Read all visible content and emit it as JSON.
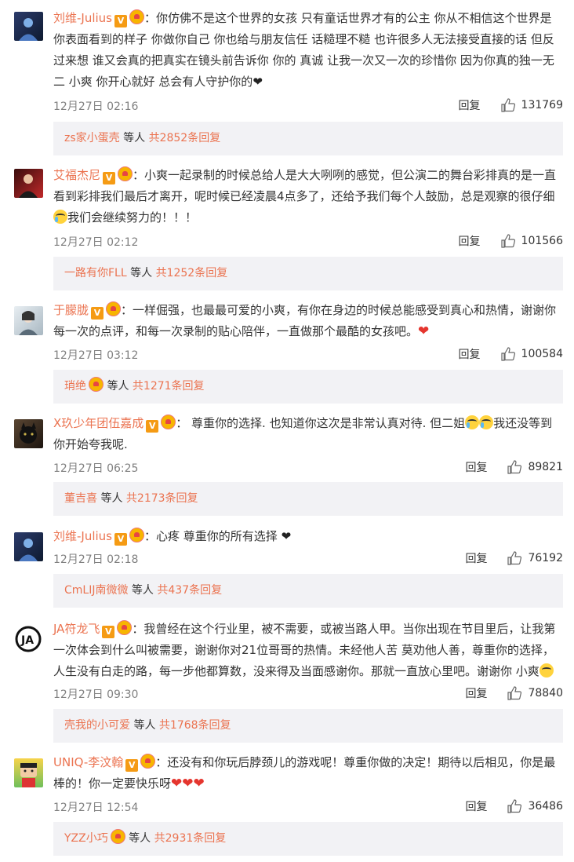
{
  "comments": [
    {
      "user": "刘维-Julius",
      "text": "：你仿佛不是这个世界的女孩 只有童话世界才有的公主 你从不相信这个世界是你表面看到的样子 你做你自己 你也给与朋友信任 话糙理不糙 也许很多人无法接受直接的话 但反过来想 谁又会真的把真实在镜头前告诉你 你的 真诚 让我一次又一次的珍惜你 因为你真的独一无二 小爽 你开心就好 总会有人守护你的",
      "end_icon": "black-heart",
      "time": "12月27日 02:16",
      "reply_label": "回复",
      "likes": "131769",
      "sub_user": "zs家小蛋壳",
      "sub_mid": " 等人 ",
      "sub_count": "共2852条回复"
    },
    {
      "user": "艾福杰尼",
      "text": "：小爽一起录制的时候总给人是大大咧咧的感觉，但公演二的舞台彩排真的是一直看到彩排我们最后才离开，呢时候已经凌晨4点多了，还给予我们每个人鼓励，总是观察的很仔细",
      "text_tail": "我们会继续努力的！！！",
      "time": "12月27日 02:12",
      "reply_label": "回复",
      "likes": "101566",
      "sub_user": "一路有你FLL",
      "sub_mid": " 等人 ",
      "sub_count": "共1252条回复"
    },
    {
      "user": "于朦胧",
      "text": "：一样倔强，也最最可爱的小爽，有你在身边的时候总能感受到真心和热情，谢谢你每一次的点评，和每一次录制的贴心陪伴，一直做那个最酷的女孩吧。",
      "time": "12月27日 03:12",
      "reply_label": "回复",
      "likes": "100584",
      "sub_user": "琑绝",
      "sub_mid": " 等人 ",
      "sub_count": "共1271条回复"
    },
    {
      "user": "X玖少年团伍嘉成",
      "text": "： 尊重你的选择. 也知道你这次是非常认真对待. 但二姐",
      "text_tail": "我还没等到你开始夸我呢.",
      "time": "12月27日 06:25",
      "reply_label": "回复",
      "likes": "89821",
      "sub_user": "董吉喜",
      "sub_mid": " 等人 ",
      "sub_count": "共2173条回复"
    },
    {
      "user": "刘维-Julius",
      "text": "：心疼 尊重你的所有选择 ",
      "time": "12月27日 02:18",
      "reply_label": "回复",
      "likes": "76192",
      "sub_user": "CmLIJ南微微",
      "sub_mid": " 等人 ",
      "sub_count": "共437条回复"
    },
    {
      "user": "JA符龙飞",
      "text": "：我曾经在这个行业里，被不需要，或被当路人甲。当你出现在节目里后，让我第一次体会到什么叫被需要，谢谢你对21位哥哥的热情。未经他人苦 莫劝他人善，尊重你的选择，人生没有白走的路，每一步他都算数，没来得及当面感谢你。那就一直放心里吧。谢谢你 小爽",
      "time": "12月27日 09:30",
      "reply_label": "回复",
      "likes": "78840",
      "sub_user": "壳我的小可爱",
      "sub_mid": " 等人 ",
      "sub_count": "共1768条回复"
    },
    {
      "user": "UNIQ-李汶翰",
      "text": "：还没有和你玩后脖颈儿的游戏呢！尊重你做的决定！期待以后相见，你是最棒的！你一定要快乐呀",
      "time": "12月27日 12:54",
      "reply_label": "回复",
      "likes": "36486",
      "sub_user": "YZZ小巧",
      "sub_mid": " 等人 ",
      "sub_count": "共2931条回复"
    }
  ],
  "colors": {
    "name": "#eb7350",
    "time": "#808080",
    "subbox_bg": "#f2f2f5"
  }
}
